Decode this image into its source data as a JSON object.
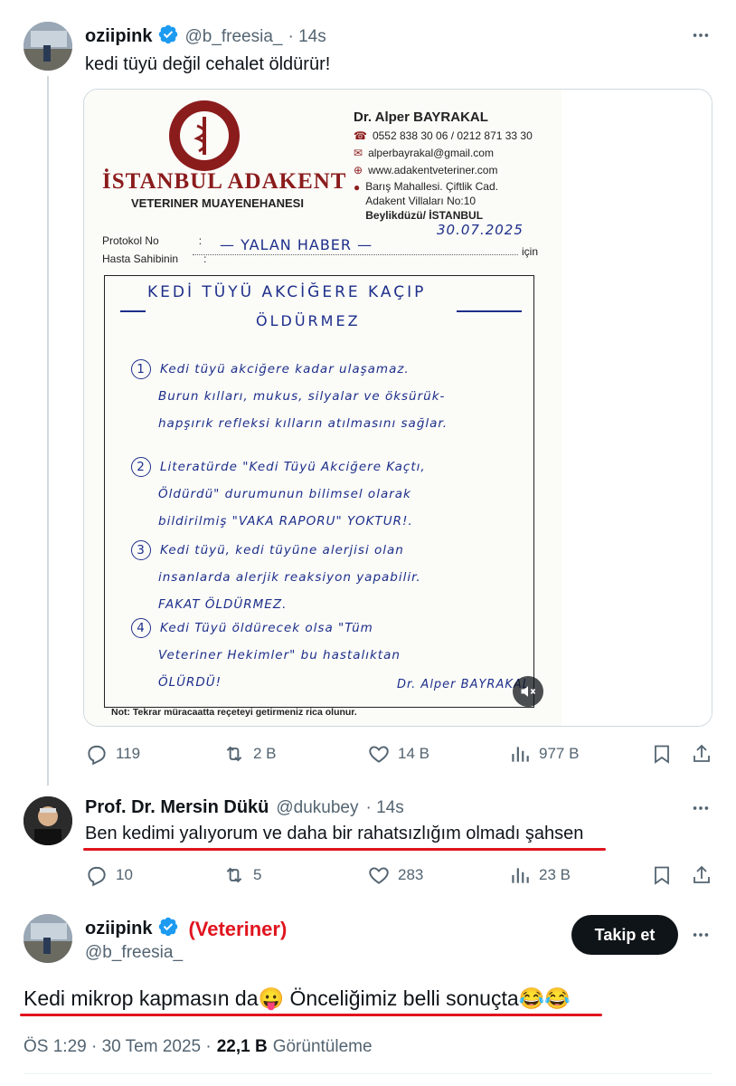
{
  "tweet1": {
    "name": "oziipink",
    "handle": "@b_freesia_",
    "time": "· 14s",
    "text": "kedi tüyü değil cehalet öldürür!",
    "stats": {
      "replies": "119",
      "retweets": "2 B",
      "likes": "14 B",
      "views": "977 B"
    }
  },
  "document": {
    "clinic_name": "İSTANBUL ADAKENT",
    "clinic_sub": "VETERINER MUAYENEHANESI",
    "doctor": "Dr. Alper BAYRAKAL",
    "phone": "0552 838 30 06 / 0212 871 33 30",
    "email": "alperbayrakal@gmail.com",
    "web": "www.adakentveteriner.com",
    "address1": "Barış Mahallesi. Çiftlik Cad.",
    "address2": "Adakent Villaları No:10",
    "address3": "Beylikdüzü/ İSTANBUL",
    "protokol_label": "Protokol No",
    "hasta_label": "Hasta Sahibinin",
    "colon": ":",
    "date": "30.07.2025",
    "icin": "için",
    "yalan": "— YALAN HABER —",
    "heading1": "KEDİ TÜYÜ AKCİĞERE KAÇIP",
    "heading2": "ÖLDÜRMEZ",
    "item1_num": "1",
    "item1_l1": "Kedi tüyü akciğere kadar ulaşamaz.",
    "item1_l2": "Burun kılları, mukus, silyalar ve öksürük-",
    "item1_l3": "hapşırık refleksi kılların atılmasını sağlar.",
    "item2_num": "2",
    "item2_l1": "Literatürde \"Kedi Tüyü Akciğere Kaçtı,",
    "item2_l2": "Öldürdü\" durumunun bilimsel olarak",
    "item2_l3": "bildirilmiş \"VAKA RAPORU\" YOKTUR!.",
    "item3_num": "3",
    "item3_l1": "Kedi tüyü, kedi tüyüne alerjisi olan",
    "item3_l2": "insanlarda alerjik reaksiyon yapabilir.",
    "item3_l3": "FAKAT ÖLDÜRMEZ.",
    "item4_num": "4",
    "item4_l1": "Kedi Tüyü öldürecek olsa \"Tüm",
    "item4_l2": "Veteriner Hekimler\" bu hastalıktan",
    "item4_l3": "ÖLÜRDÜ!",
    "signature": "Dr. Alper BAYRAKAL",
    "footer": "Not: Tekrar müracaatta reçeteyi getirmeniz rica olunur."
  },
  "tweet2": {
    "name": "Prof. Dr. Mersin Dükü",
    "handle": "@dukubey",
    "time": "· 14s",
    "text": "Ben kedimi yalıyorum ve daha bir rahatsızlığım olmadı şahsen",
    "stats": {
      "replies": "10",
      "retweets": "5",
      "likes": "283",
      "views": "23 B"
    }
  },
  "tweet3": {
    "name": "oziipink",
    "annotation": "(Veteriner)",
    "handle": "@b_freesia_",
    "follow_label": "Takip et",
    "text": "Kedi mikrop kapmasın da😛 Önceliğimiz belli sonuçta😂😂",
    "timestamp": "ÖS 1:29 · 30 Tem 2025 ·",
    "views_count": "22,1 B",
    "views_label": "Görüntüleme"
  },
  "colors": {
    "accent": "#1d9bf0",
    "text": "#0f1419",
    "muted": "#536471",
    "annotation_red": "#e0141e",
    "clinic_red": "#8b1c1c"
  }
}
